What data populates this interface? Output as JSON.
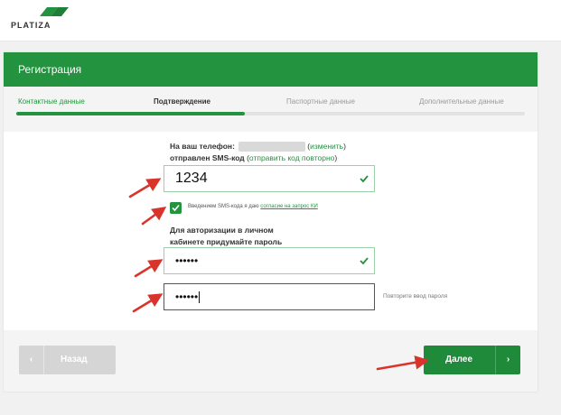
{
  "brand": {
    "name": "PLATIZA",
    "color": "#23933f"
  },
  "card": {
    "title": "Регистрация"
  },
  "steps": [
    {
      "label": "Контактные данные",
      "state": "done"
    },
    {
      "label": "Подтверждение",
      "state": "active"
    },
    {
      "label": "Паспортные данные",
      "state": "pending"
    },
    {
      "label": "Дополнительные данные",
      "state": "pending"
    }
  ],
  "progress": 0.45,
  "sms": {
    "line1_prefix": "На ваш телефон:",
    "change_link": "изменить",
    "line2_prefix": "отправлен SMS-код",
    "resend_link": "отправить код повторно",
    "code_value": "1234"
  },
  "consent": {
    "checked": true,
    "text": "Введением SMS-кода я даю",
    "link": "согласие на запрос КИ"
  },
  "password": {
    "label_line1": "Для авторизации в личном",
    "label_line2": "кабинете придумайте пароль",
    "value": "••••••",
    "repeat_value": "••••••",
    "repeat_hint": "Повторите ввод пароля"
  },
  "buttons": {
    "back_label": "Назад",
    "next_label": "Далее",
    "back_arrow": "‹",
    "next_arrow": "›"
  },
  "icons": {
    "check": "check-icon",
    "arrow_left": "chevron-left-icon",
    "arrow_right": "chevron-right-icon",
    "annotation": "red-arrow-icon"
  }
}
